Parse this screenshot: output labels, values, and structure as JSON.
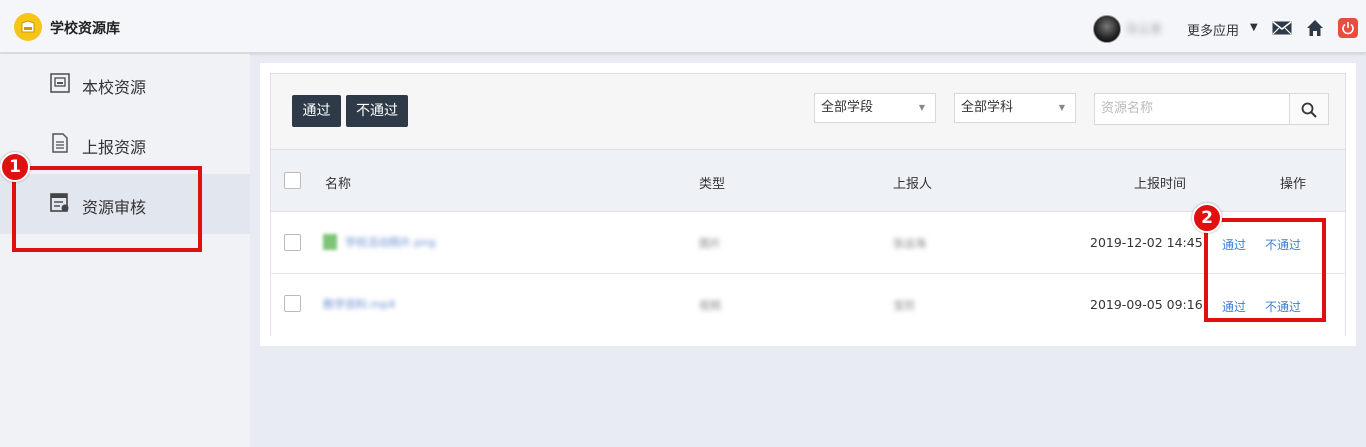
{
  "header": {
    "app_title": "学校资源库",
    "username": "张云果",
    "more_apps": "更多应用",
    "icons": [
      "logo-icon",
      "mail-icon",
      "home-icon",
      "power-icon"
    ]
  },
  "sidebar": {
    "items": [
      {
        "label": "本校资源",
        "icon": "archive-icon",
        "active": false
      },
      {
        "label": "上报资源",
        "icon": "document-icon",
        "active": false
      },
      {
        "label": "资源审核",
        "icon": "review-icon",
        "active": true
      }
    ]
  },
  "toolbar": {
    "approve_label": "通过",
    "reject_label": "不通过",
    "stage_select": "全部学段",
    "subject_select": "全部学科",
    "search_placeholder": "资源名称"
  },
  "table": {
    "columns": [
      "名称",
      "类型",
      "上报人",
      "上报时间",
      "操作"
    ],
    "rows": [
      {
        "name": "学校活动照片.png",
        "type": "图片",
        "reporter": "张运海",
        "time": "2019-12-02 14:45",
        "approve": "通过",
        "reject": "不通过"
      },
      {
        "name": "教学资料.mp4",
        "type": "视频",
        "reporter": "宝欣",
        "time": "2019-09-05 09:16",
        "approve": "通过",
        "reject": "不通过"
      }
    ]
  },
  "annotations": {
    "markers": [
      "1",
      "2"
    ],
    "color": "#e01010"
  },
  "colors": {
    "dark_button": "#2e3a48",
    "link": "#3b7fd4",
    "logo": "#f5c518",
    "power": "#e84d3d"
  }
}
